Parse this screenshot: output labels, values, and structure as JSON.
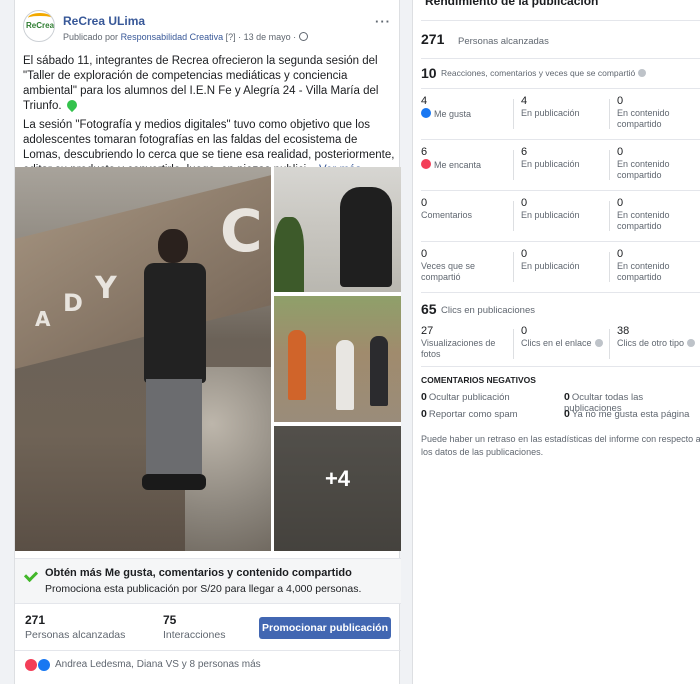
{
  "post": {
    "page_name": "ReCrea ULima",
    "avatar_label": "ReCrea",
    "meta_prefix": "Publicado por",
    "meta_author": "Responsabilidad Creativa",
    "meta_suffix": "[?] · 13 de mayo ·",
    "menu_label": "···",
    "paragraph1": "El sábado 11, integrantes de Recrea ofrecieron la segunda sesión del \"Taller de exploración de competencias mediáticas y conciencia ambiental\" para los alumnos del I.E.N Fe y Alegría 24 - Villa María del Triunfo.",
    "paragraph2": "La sesión \"Fotografía y medios digitales\" tuvo como objetivo que los adolescentes tomaran fotografías en las faldas del ecosistema de Lomas, descubriendo lo cerca que se tiene esa realidad, posteriormente, editar su producto y convertirlo, luego, en piezas publici...",
    "see_more": "Ver más",
    "wall_letters": [
      "A",
      "D",
      "Y",
      "C"
    ],
    "more_photos": "+4",
    "boost_title": "Obtén más Me gusta, comentarios y contenido compartido",
    "boost_sub": "Promociona esta publicación por S/20 para llegar a 4,000 personas.",
    "reach_value": "271",
    "reach_label": "Personas alcanzadas",
    "interactions_value": "75",
    "interactions_label": "Interacciones",
    "promote_button": "Promocionar publicación",
    "reactors": "Andrea Ledesma, Diana VS y 8 personas más"
  },
  "panel": {
    "title": "Rendimiento de la publicación",
    "reach_value": "271",
    "reach_label": "Personas alcanzadas",
    "engagement_value": "10",
    "engagement_label": "Reacciones, comentarios y veces que se compartió",
    "rows": [
      {
        "total": "4",
        "label": "Me gusta",
        "on_post": "4",
        "on_post_label": "En publicación",
        "shared": "0",
        "shared_label": "En contenido compartido"
      },
      {
        "total": "6",
        "label": "Me encanta",
        "on_post": "6",
        "on_post_label": "En publicación",
        "shared": "0",
        "shared_label": "En contenido compartido"
      },
      {
        "total": "0",
        "label": "Comentarios",
        "on_post": "0",
        "on_post_label": "En publicación",
        "shared": "0",
        "shared_label": "En contenido compartido"
      },
      {
        "total": "0",
        "label": "Veces que se compartió",
        "on_post": "0",
        "on_post_label": "En publicación",
        "shared": "0",
        "shared_label": "En contenido compartido"
      }
    ],
    "clicks_value": "65",
    "clicks_label": "Clics en publicaciones",
    "click_cells": [
      {
        "value": "27",
        "label": "Visualizaciones de fotos"
      },
      {
        "value": "0",
        "label": "Clics en el enlace"
      },
      {
        "value": "38",
        "label": "Clics de otro tipo"
      }
    ],
    "negative_title": "COMENTARIOS NEGATIVOS",
    "negative": [
      {
        "value": "0",
        "label": "Ocultar publicación"
      },
      {
        "value": "0",
        "label": "Ocultar todas las publicaciones"
      },
      {
        "value": "0",
        "label": "Reportar como spam"
      },
      {
        "value": "0",
        "label": "Ya no me gusta esta página"
      }
    ],
    "note": "Puede haber un retraso en las estadísticas del informe con respecto a los datos de las publicaciones."
  }
}
